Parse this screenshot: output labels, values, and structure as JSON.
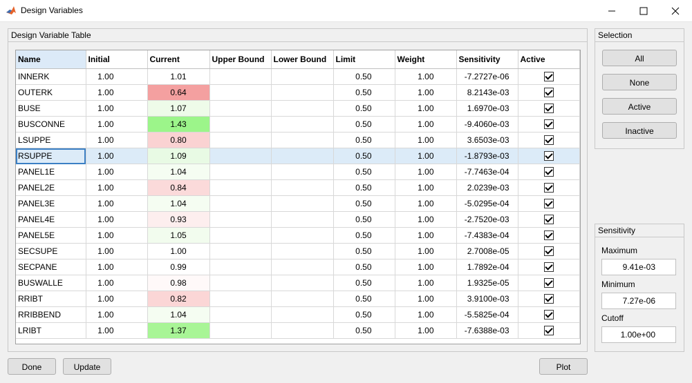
{
  "window": {
    "title": "Design Variables"
  },
  "table_panel": {
    "title": "Design Variable Table"
  },
  "columns": [
    "Name",
    "Initial",
    "Current",
    "Upper Bound",
    "Lower Bound",
    "Limit",
    "Weight",
    "Sensitivity",
    "Active"
  ],
  "rows": [
    {
      "name": "INNERK",
      "initial": "1.00",
      "current": "1.01",
      "upper": "",
      "lower": "",
      "limit": "0.50",
      "weight": "1.00",
      "sensitivity": "-7.2727e-06",
      "active": true,
      "current_color": "#ffffff"
    },
    {
      "name": "OUTERK",
      "initial": "1.00",
      "current": "0.64",
      "upper": "",
      "lower": "",
      "limit": "0.50",
      "weight": "1.00",
      "sensitivity": "8.2143e-03",
      "active": true,
      "current_color": "#f4a0a0"
    },
    {
      "name": "BUSE",
      "initial": "1.00",
      "current": "1.07",
      "upper": "",
      "lower": "",
      "limit": "0.50",
      "weight": "1.00",
      "sensitivity": "1.6970e-03",
      "active": true,
      "current_color": "#eefbe9"
    },
    {
      "name": "BUSCONNE",
      "initial": "1.00",
      "current": "1.43",
      "upper": "",
      "lower": "",
      "limit": "0.50",
      "weight": "1.00",
      "sensitivity": "-9.4060e-03",
      "active": true,
      "current_color": "#9cf58a"
    },
    {
      "name": "LSUPPE",
      "initial": "1.00",
      "current": "0.80",
      "upper": "",
      "lower": "",
      "limit": "0.50",
      "weight": "1.00",
      "sensitivity": "3.6503e-03",
      "active": true,
      "current_color": "#fad2d2"
    },
    {
      "name": "RSUPPE",
      "initial": "1.00",
      "current": "1.09",
      "upper": "",
      "lower": "",
      "limit": "0.50",
      "weight": "1.00",
      "sensitivity": "-1.8793e-03",
      "active": true,
      "current_color": "#e8fae4",
      "selected": true
    },
    {
      "name": "PANEL1E",
      "initial": "1.00",
      "current": "1.04",
      "upper": "",
      "lower": "",
      "limit": "0.50",
      "weight": "1.00",
      "sensitivity": "-7.7463e-04",
      "active": true,
      "current_color": "#f5fdf2"
    },
    {
      "name": "PANEL2E",
      "initial": "1.00",
      "current": "0.84",
      "upper": "",
      "lower": "",
      "limit": "0.50",
      "weight": "1.00",
      "sensitivity": "2.0239e-03",
      "active": true,
      "current_color": "#fbdada"
    },
    {
      "name": "PANEL3E",
      "initial": "1.00",
      "current": "1.04",
      "upper": "",
      "lower": "",
      "limit": "0.50",
      "weight": "1.00",
      "sensitivity": "-5.0295e-04",
      "active": true,
      "current_color": "#f5fdf2"
    },
    {
      "name": "PANEL4E",
      "initial": "1.00",
      "current": "0.93",
      "upper": "",
      "lower": "",
      "limit": "0.50",
      "weight": "1.00",
      "sensitivity": "-2.7520e-03",
      "active": true,
      "current_color": "#fdeeee"
    },
    {
      "name": "PANEL5E",
      "initial": "1.00",
      "current": "1.05",
      "upper": "",
      "lower": "",
      "limit": "0.50",
      "weight": "1.00",
      "sensitivity": "-7.4383e-04",
      "active": true,
      "current_color": "#f2fcee"
    },
    {
      "name": "SECSUPE",
      "initial": "1.00",
      "current": "1.00",
      "upper": "",
      "lower": "",
      "limit": "0.50",
      "weight": "1.00",
      "sensitivity": "2.7008e-05",
      "active": true,
      "current_color": "#ffffff"
    },
    {
      "name": "SECPANE",
      "initial": "1.00",
      "current": "0.99",
      "upper": "",
      "lower": "",
      "limit": "0.50",
      "weight": "1.00",
      "sensitivity": "1.7892e-04",
      "active": true,
      "current_color": "#ffffff"
    },
    {
      "name": "BUSWALLE",
      "initial": "1.00",
      "current": "0.98",
      "upper": "",
      "lower": "",
      "limit": "0.50",
      "weight": "1.00",
      "sensitivity": "1.9325e-05",
      "active": true,
      "current_color": "#fff9f9"
    },
    {
      "name": "RRIBT",
      "initial": "1.00",
      "current": "0.82",
      "upper": "",
      "lower": "",
      "limit": "0.50",
      "weight": "1.00",
      "sensitivity": "3.9100e-03",
      "active": true,
      "current_color": "#fbd6d6"
    },
    {
      "name": "RRIBBEND",
      "initial": "1.00",
      "current": "1.04",
      "upper": "",
      "lower": "",
      "limit": "0.50",
      "weight": "1.00",
      "sensitivity": "-5.5825e-04",
      "active": true,
      "current_color": "#f5fdf2"
    },
    {
      "name": "LRIBT",
      "initial": "1.00",
      "current": "1.37",
      "upper": "",
      "lower": "",
      "limit": "0.50",
      "weight": "1.00",
      "sensitivity": "-7.6388e-03",
      "active": true,
      "current_color": "#a8f596"
    }
  ],
  "selection": {
    "title": "Selection",
    "all": "All",
    "none": "None",
    "active": "Active",
    "inactive": "Inactive"
  },
  "sensitivity": {
    "title": "Sensitivity",
    "max_label": "Maximum",
    "max_value": "9.41e-03",
    "min_label": "Minimum",
    "min_value": "7.27e-06",
    "cutoff_label": "Cutoff",
    "cutoff_value": "1.00e+00"
  },
  "buttons": {
    "done": "Done",
    "update": "Update",
    "plot": "Plot"
  }
}
